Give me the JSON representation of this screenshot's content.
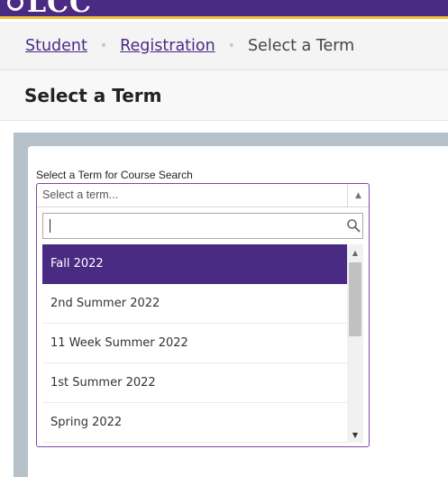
{
  "header": {
    "logo_text": "LCC",
    "brand_color": "#4a2b84",
    "accent_color": "#f2c230"
  },
  "breadcrumb": {
    "items": [
      {
        "label": "Student"
      },
      {
        "label": "Registration"
      },
      {
        "label": "Select a Term"
      }
    ],
    "separator": "•"
  },
  "page": {
    "title": "Select a Term"
  },
  "term_select": {
    "label": "Select a Term for Course Search",
    "placeholder": "Select a term...",
    "arrow_glyph": "▲",
    "search": {
      "value": "",
      "icon": "search-icon"
    },
    "options": [
      {
        "label": "Fall 2022",
        "selected": true
      },
      {
        "label": "2nd Summer 2022",
        "selected": false
      },
      {
        "label": "11 Week Summer 2022",
        "selected": false
      },
      {
        "label": "1st Summer 2022",
        "selected": false
      },
      {
        "label": "Spring 2022",
        "selected": false
      }
    ],
    "scroll_up_glyph": "▲",
    "scroll_down_glyph": "▼"
  }
}
